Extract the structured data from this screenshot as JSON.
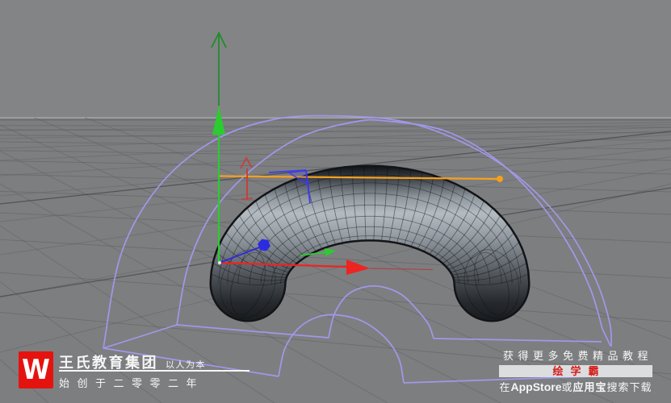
{
  "watermarks": {
    "left": {
      "logo_letter": "W",
      "company": "王氏教育集团",
      "slogan": "以人为本",
      "since": "始创于二零零二年"
    },
    "right": {
      "line1": "获得更多免费精品教程",
      "brand": "绘学霸",
      "download_prefix": "在",
      "download_store": "AppStore",
      "download_or": "或",
      "download_app": "应用宝",
      "download_suffix": "搜索下载"
    }
  },
  "scene": {
    "elements": [
      "ground-grid",
      "arch-spline",
      "half-torus-mesh",
      "move-gizmo",
      "measure-line"
    ],
    "colors": {
      "sky": "#838486",
      "ground": "#7d7e80",
      "horizon_light": "#b0b1b3",
      "horizon_dark": "#636467",
      "grid": "#5e6064",
      "grid_dark": "#3f4246",
      "spline_purple": "#a29af0",
      "orange": "#f7a01d",
      "axis_green": "#2bcc30",
      "axis_green_dark": "#1f8c26",
      "axis_red": "#ee2420",
      "axis_red_dim": "#c22a20",
      "axis_blue": "#2b2be0",
      "handle_red": "#cf3a33",
      "handle_blue": "#3a3af2",
      "origin_dot": "#dff5df",
      "torus_outline": "#0d0f12",
      "torus_wire": "rgba(8,10,13,0.72)",
      "torus_stops": [
        [
          0,
          "#0e1013"
        ],
        [
          0.08,
          "#3a3f44"
        ],
        [
          0.2,
          "#8f979e"
        ],
        [
          0.3,
          "#b4bbc1"
        ],
        [
          0.44,
          "#959ca3"
        ],
        [
          0.58,
          "#6d7379"
        ],
        [
          0.72,
          "#464b50"
        ],
        [
          0.86,
          "#25282c"
        ],
        [
          1,
          "#16181b"
        ]
      ],
      "logo_red": "#e5130f",
      "brand_red": "#d61e1a",
      "bar_bg": "#dcdddf",
      "text_white": "#f6f6f6"
    }
  }
}
